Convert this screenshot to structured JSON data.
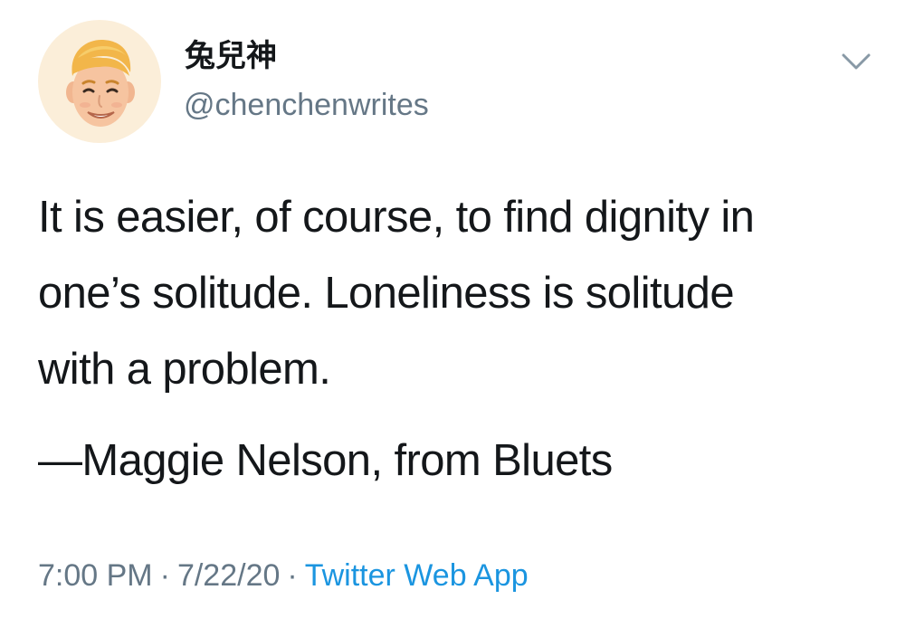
{
  "author": {
    "display_name": "兔兒神",
    "handle": "@chenchenwrites"
  },
  "tweet": {
    "lines": [
      "It is easier, of course, to find dignity in",
      "one’s solitude. Loneliness is solitude",
      "with a problem."
    ],
    "attribution": "—Maggie Nelson, from Bluets"
  },
  "meta": {
    "time": "7:00 PM",
    "separator": "·",
    "date": "7/22/20",
    "source": "Twitter Web App"
  },
  "icons": {
    "menu": "chevron-down-icon",
    "avatar": "memoji-avatar"
  },
  "colors": {
    "text": "#14171a",
    "secondary": "#657786",
    "link": "#1b95e0",
    "avatar_bg": "#fbeed9"
  }
}
